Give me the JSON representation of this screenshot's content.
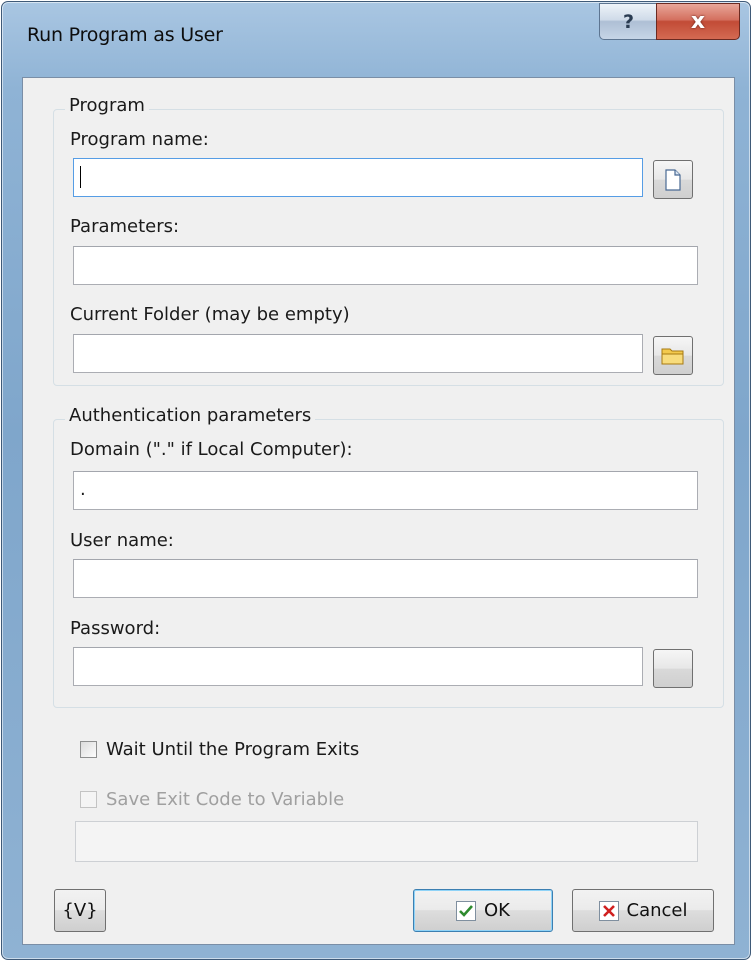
{
  "window": {
    "title": "Run Program as User",
    "help_glyph": "?",
    "close_glyph": "x"
  },
  "program_group": {
    "legend": "Program",
    "program_name_label": "Program name:",
    "program_name_value": "",
    "parameters_label": "Parameters:",
    "parameters_value": "",
    "current_folder_label": "Current Folder (may be empty)",
    "current_folder_value": "",
    "browse_file_icon": "file-icon",
    "browse_folder_icon": "folder-icon"
  },
  "auth_group": {
    "legend": "Authentication parameters",
    "domain_label": "Domain (\".\" if Local Computer):",
    "domain_value": ".",
    "user_label": "User name:",
    "user_value": "",
    "password_label": "Password:",
    "password_value": ""
  },
  "options": {
    "wait_label": "Wait Until the Program Exits",
    "wait_checked": false,
    "save_exit_label": "Save Exit Code to Variable",
    "save_exit_checked": false,
    "save_exit_enabled": false,
    "variable_value": ""
  },
  "buttons": {
    "variables": "{V}",
    "ok": "OK",
    "cancel": "Cancel"
  },
  "colors": {
    "title_bar": "#8fb3d5",
    "close_button": "#c24b36",
    "dialog_bg": "#f0f0f0",
    "ok_icon": "#2e8b2e",
    "cancel_icon": "#d02020"
  }
}
